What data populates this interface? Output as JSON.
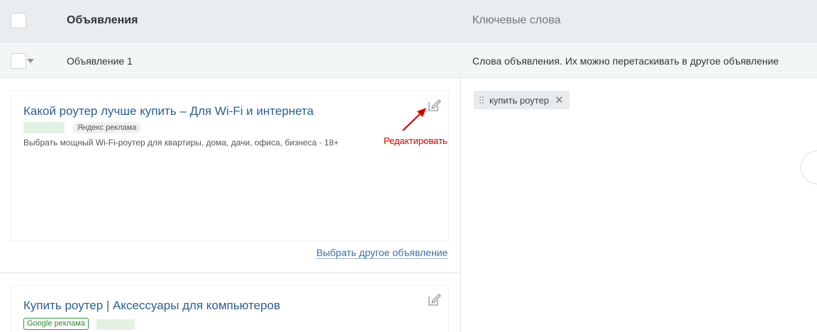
{
  "header": {
    "ads_title": "Объявления",
    "keywords_title": "Ключевые слова"
  },
  "group": {
    "name": "Объявление 1",
    "keywords_hint": "Слова объявления. Их можно перетаскивать в другое объявление"
  },
  "ads": [
    {
      "title": "Какой роутер лучше купить – Для Wi-Fi и интернета",
      "badge": "Яндекс реклама",
      "description": "Выбрать мощный Wi-Fi-роутер для квартиры, дома, дачи, офиса, бизнеса · 18+"
    },
    {
      "title": "Купить роутер | Аксессуары для компьютеров",
      "badge": "Google реклама"
    }
  ],
  "annotation": {
    "label": "Редактировать",
    "color": "#d40000"
  },
  "actions": {
    "choose_other": "Выбрать другое объявление"
  },
  "keywords": [
    {
      "text": "купить роутер",
      "remove_icon": "close-icon"
    }
  ],
  "colors": {
    "header_bg": "#e9edf0",
    "link": "#2c5f8f",
    "google_green": "#2a9a3a"
  }
}
